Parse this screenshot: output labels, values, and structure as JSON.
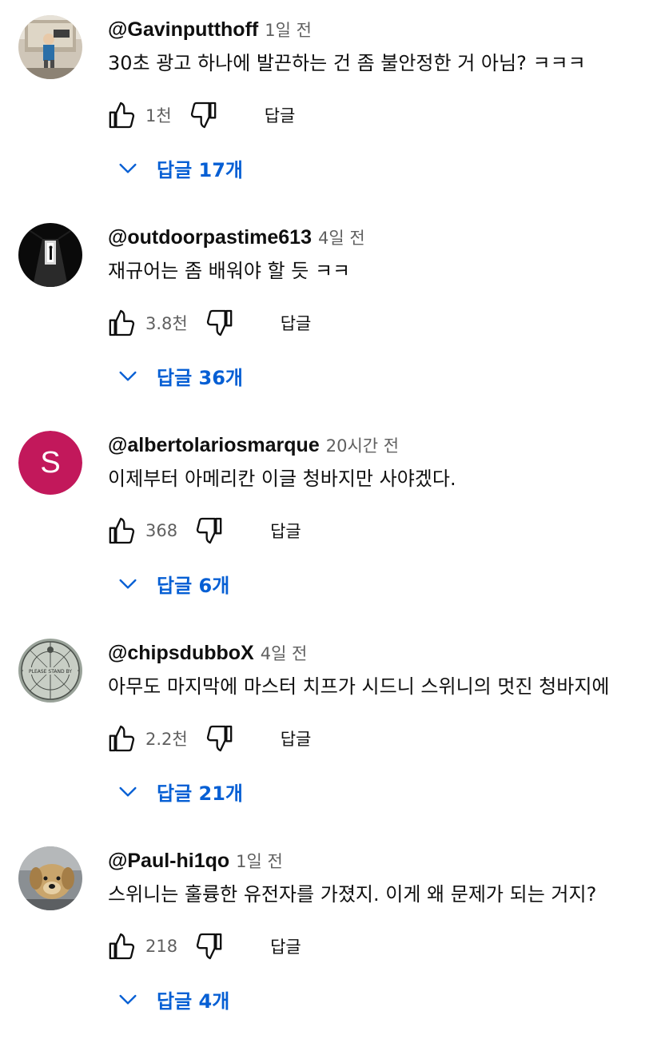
{
  "colors": {
    "accent": "#065fd4",
    "secondary_text": "#606060",
    "primary_text": "#0f0f0f",
    "avatar_s_bg": "#c2185b"
  },
  "comments": [
    {
      "author": "@Gavinputthoff",
      "time": "1일 전",
      "text": "30초 광고 하나에 발끈하는 건 좀 불안정한 거 아님? ㅋㅋㅋ",
      "likes": "1천",
      "reply_label": "답글",
      "replies_label": "답글 17개",
      "avatar": "photo-person-icon"
    },
    {
      "author": "@outdoorpastime613",
      "time": "4일 전",
      "text": "재규어는 좀 배워야 할 듯 ㅋㅋ",
      "likes": "3.8천",
      "reply_label": "답글",
      "replies_label": "답글 36개",
      "avatar": "photo-dark-hallway-icon"
    },
    {
      "author": "@albertolariosmarque",
      "time": "20시간 전",
      "text": "이제부터 아메리칸 이글 청바지만 사야겠다.",
      "likes": "368",
      "reply_label": "답글",
      "replies_label": "답글 6개",
      "avatar_letter": "S"
    },
    {
      "author": "@chipsdubboX",
      "time": "4일 전",
      "text": "아무도 마지막에 마스터 치프가 시드니 스위니의 멋진 청바지에",
      "likes": "2.2천",
      "reply_label": "답글",
      "replies_label": "답글 21개",
      "avatar": "please-stand-by-icon",
      "avatar_text": "PLEASE STAND BY"
    },
    {
      "author": "@Paul-hi1qo",
      "time": "1일 전",
      "text": "스위니는 훌륭한 유전자를 가졌지. 이게 왜 문제가 되는 거지?",
      "likes": "218",
      "reply_label": "답글",
      "replies_label": "답글 4개",
      "avatar": "photo-dog-icon"
    }
  ]
}
